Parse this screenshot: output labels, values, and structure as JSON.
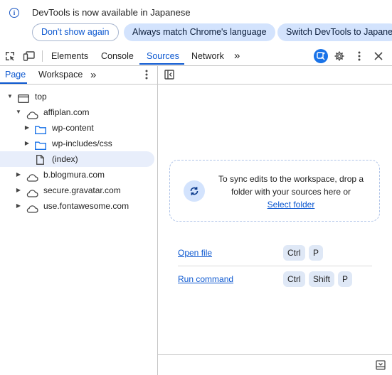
{
  "infobar": {
    "message": "DevTools is now available in Japanese",
    "dont_show": "Don't show again",
    "always_match": "Always match Chrome's language",
    "switch": "Switch DevTools to Japanese"
  },
  "toolbar": {
    "tabs": [
      "Elements",
      "Console",
      "Sources",
      "Network"
    ],
    "active_tab": "Sources",
    "more": "»"
  },
  "navigator": {
    "tabs": [
      "Page",
      "Workspace"
    ],
    "active_tab": "Page",
    "more": "»",
    "tree": [
      {
        "label": "top",
        "type": "frame"
      },
      {
        "label": "affiplan.com",
        "type": "domain"
      },
      {
        "label": "wp-content",
        "type": "folder"
      },
      {
        "label": "wp-includes/css",
        "type": "folder"
      },
      {
        "label": "(index)",
        "type": "file",
        "selected": true
      },
      {
        "label": "b.blogmura.com",
        "type": "domain"
      },
      {
        "label": "secure.gravatar.com",
        "type": "domain"
      },
      {
        "label": "use.fontawesome.com",
        "type": "domain"
      }
    ]
  },
  "editor": {
    "drop_text_1": "To sync edits to the workspace, drop a",
    "drop_text_2": "folder with your sources here or",
    "select_folder": "Select folder",
    "open_file": "Open file",
    "open_file_keys": [
      "Ctrl",
      "P"
    ],
    "run_command": "Run command",
    "run_command_keys": [
      "Ctrl",
      "Shift",
      "P"
    ]
  },
  "colors": {
    "accent": "#0b57d0",
    "pill": "#d3e3fd"
  }
}
